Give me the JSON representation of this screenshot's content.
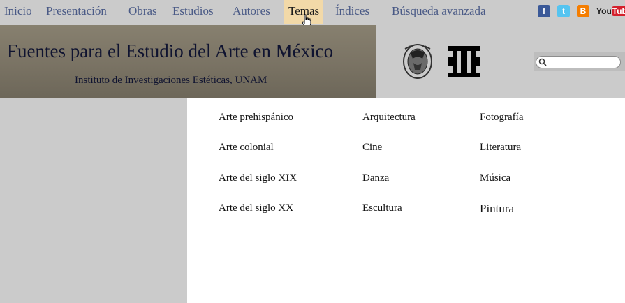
{
  "nav": {
    "items": [
      {
        "label": "Inicio"
      },
      {
        "label": "Presentación"
      },
      {
        "label": "Obras"
      },
      {
        "label": "Estudios"
      },
      {
        "label": "Autores"
      },
      {
        "label": "Temas"
      },
      {
        "label": "Índices"
      },
      {
        "label": "Búsqueda avanzada"
      }
    ],
    "active": "Temas"
  },
  "social": {
    "facebook_icon": "facebook-icon",
    "twitter_icon": "twitter-icon",
    "blogger_icon": "blogger-icon",
    "youtube": {
      "you": "You",
      "tube": "Tube"
    }
  },
  "header": {
    "title": "Fuentes para el Estudio del Arte en México",
    "subtitle": "Instituto de Investigaciones Estéticas, UNAM"
  },
  "search": {
    "placeholder": ""
  },
  "topics": {
    "col1": [
      "Arte prehispánico",
      "Arte colonial",
      "Arte del siglo XIX",
      "Arte del siglo XX"
    ],
    "col2": [
      "Arquitectura",
      "Cine",
      "Danza",
      "Escultura"
    ],
    "col3": [
      "Fotografía",
      "Literatura",
      "Música",
      "Pintura"
    ]
  },
  "colors": {
    "nav_text": "#4a5a86",
    "active_bg": "#f2d9a8",
    "page_bg": "#cbcbcb",
    "title_text": "#0f1330"
  }
}
